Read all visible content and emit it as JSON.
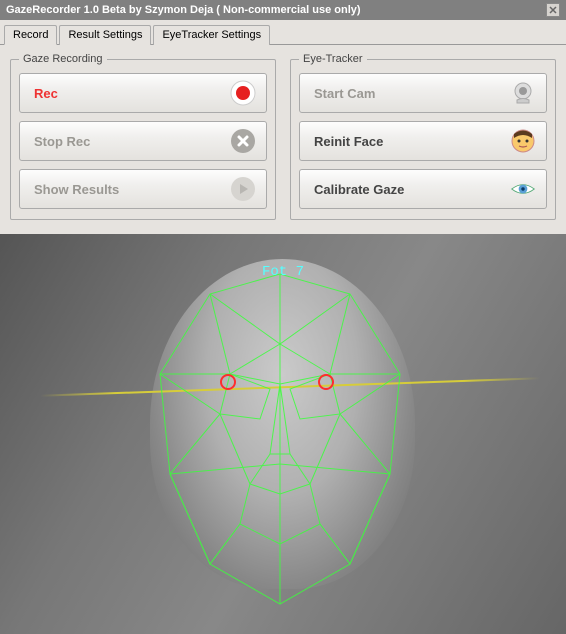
{
  "title": "GazeRecorder 1.0 Beta  by Szymon Deja  ( Non-commercial use only)",
  "tabs": {
    "record": "Record",
    "result": "Result Settings",
    "tracker": "EyeTracker Settings"
  },
  "groups": {
    "gaze": "Gaze Recording",
    "eye": "Eye-Tracker"
  },
  "buttons": {
    "rec": "Rec",
    "stop": "Stop Rec",
    "results": "Show Results",
    "startcam": "Start Cam",
    "reinit": "Reinit Face",
    "calibrate": "Calibrate Gaze"
  },
  "overlay": "Fot 7"
}
